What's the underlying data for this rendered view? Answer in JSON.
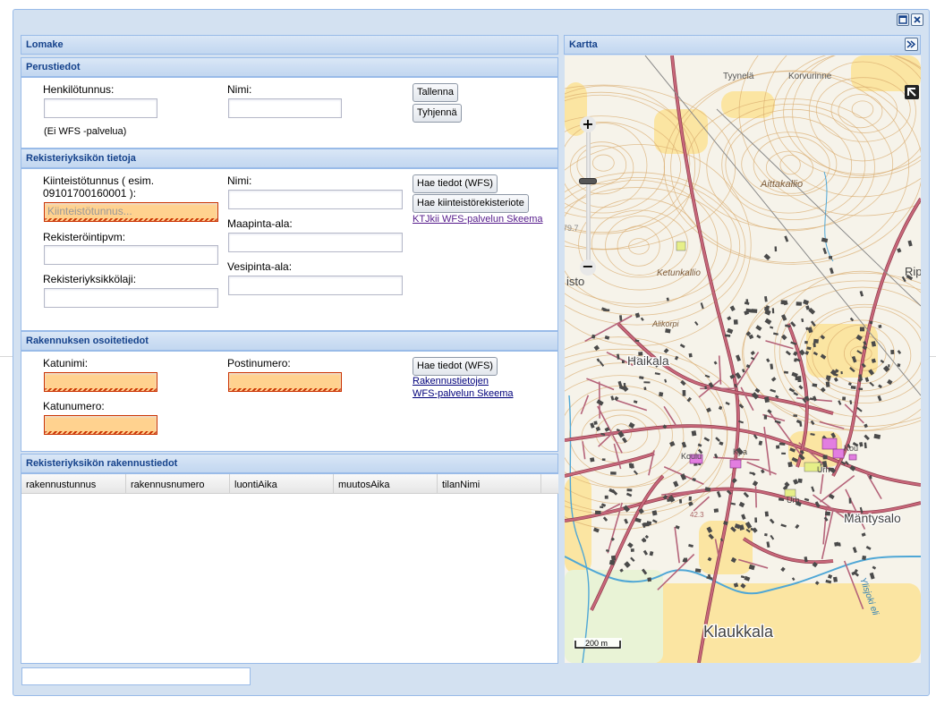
{
  "window": {
    "maximize_icon": "maximize-icon",
    "close_icon": "close-icon"
  },
  "form": {
    "title": "Lomake",
    "basic": {
      "title": "Perustiedot",
      "ssn_label": "Henkilötunnus:",
      "ssn_value": "",
      "name_label": "Nimi:",
      "name_value": "",
      "save_button": "Tallenna",
      "clear_button": "Tyhjennä",
      "note": "(Ei WFS -palvelua)"
    },
    "parcel": {
      "title": "Rekisteriyksikön tietoja",
      "property_id_label_line1": "Kiinteistötunnus ( esim.",
      "property_id_label_line2": "09101700160001 ):",
      "property_id_placeholder": "Kiinteistötunnus...",
      "registration_date_label": "Rekisteröintipvm:",
      "unit_type_label": "Rekisteriyksikkölaji:",
      "name_label": "Nimi:",
      "land_area_label": "Maapinta-ala:",
      "water_area_label": "Vesipinta-ala:",
      "fetch_button": "Hae tiedot (WFS)",
      "register_extract_button": "Hae kiinteistörekisteriote",
      "schema_link": "KTJkii WFS-palvelun Skeema"
    },
    "building_address": {
      "title": "Rakennuksen osoitetiedot",
      "street_label": "Katunimi:",
      "postal_label": "Postinumero:",
      "number_label": "Katunumero:",
      "fetch_button": "Hae tiedot (WFS)",
      "link_line1": "Rakennustietojen",
      "link_line2": "WFS-palvelun Skeema"
    },
    "buildings": {
      "title": "Rekisteriyksikön rakennustiedot",
      "columns": [
        "rakennustunnus",
        "rakennusnumero",
        "luontiAika",
        "muutosAika",
        "tilanNimi"
      ],
      "rows": []
    }
  },
  "map": {
    "title": "Kartta",
    "collapse_icon": "double-chevron-right-icon",
    "zoom_in": "+",
    "zoom_out": "−",
    "zoom_level_fraction": 0.62,
    "scale_label": "200 m",
    "places": [
      "Tyynelä",
      "Korvurinne",
      "Aittakallio",
      "Ketunkallio",
      "Alikorpi",
      "Haikala",
      "Mäntysalo",
      "Klaukkala",
      "Ylisjoki eli",
      "isto",
      "Rip",
      "Kpa",
      "Koulu",
      "Kou",
      "Urh",
      "Urh"
    ],
    "elevation_label": "79.7",
    "contour_labels": [
      "42.3"
    ],
    "colors": {
      "road": "#c8677a",
      "building": "#4a4a4a",
      "field": "#fbe5a2",
      "water": "#4fa7d6",
      "contour": "#d8a96b"
    }
  },
  "statusbar": {
    "text": ""
  }
}
